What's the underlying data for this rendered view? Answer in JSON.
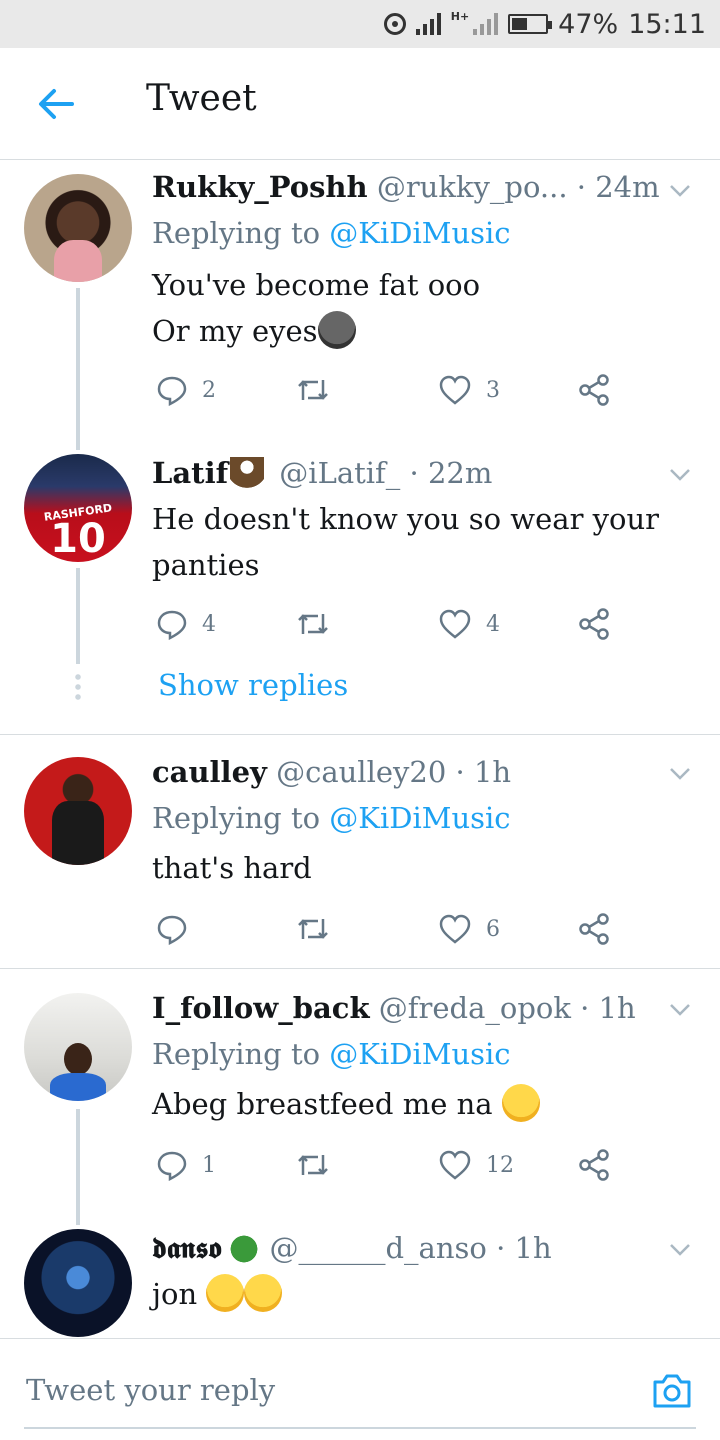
{
  "status_bar": {
    "battery": "47%",
    "time": "15:11",
    "network": "H+",
    "battery_level": 0.47
  },
  "header": {
    "title": "Tweet",
    "back_icon": "arrow-left-icon"
  },
  "tweets": [
    {
      "name": "Rukky_Poshh",
      "handle": "@rukky_po...",
      "sep": "·",
      "time": "24m",
      "replying_prefix": "Replying to",
      "replying_to": "@KiDiMusic",
      "text_line1": "You've become fat ooo",
      "text_line2": "Or my eyes",
      "replies": "2",
      "retweets": "",
      "likes": "3"
    },
    {
      "name": "Latif",
      "handle": "@iLatif_",
      "sep": "·",
      "time": "22m",
      "text_line1": "He doesn't know you so wear your",
      "text_line2": "panties",
      "replies": "4",
      "retweets": "",
      "likes": "4",
      "show_replies": "Show replies",
      "avatar_text": "RASHFORD",
      "avatar_number": "10"
    },
    {
      "name": "caulley",
      "handle": "@caulley20",
      "sep": "·",
      "time": "1h",
      "replying_prefix": "Replying to",
      "replying_to": "@KiDiMusic",
      "text_line1": "that's hard",
      "replies": "",
      "retweets": "",
      "likes": "6"
    },
    {
      "name": "I_follow_back",
      "handle": "@freda_opok",
      "sep": "·",
      "time": "1h",
      "replying_prefix": "Replying to",
      "replying_to": "@KiDiMusic",
      "text_line1": "Abeg breastfeed me na",
      "replies": "1",
      "retweets": "",
      "likes": "12"
    },
    {
      "name": "𝖉𝖆𝖓𝖘𝖔",
      "handle": "@______d_anso",
      "sep": "·",
      "time": "1h",
      "text_line1": "jon"
    }
  ],
  "reply_box": {
    "placeholder": "Tweet your reply",
    "camera_icon": "camera-icon"
  },
  "colors": {
    "accent": "#1da1f2",
    "secondary_text": "#657786",
    "divider": "#d8dde0"
  }
}
